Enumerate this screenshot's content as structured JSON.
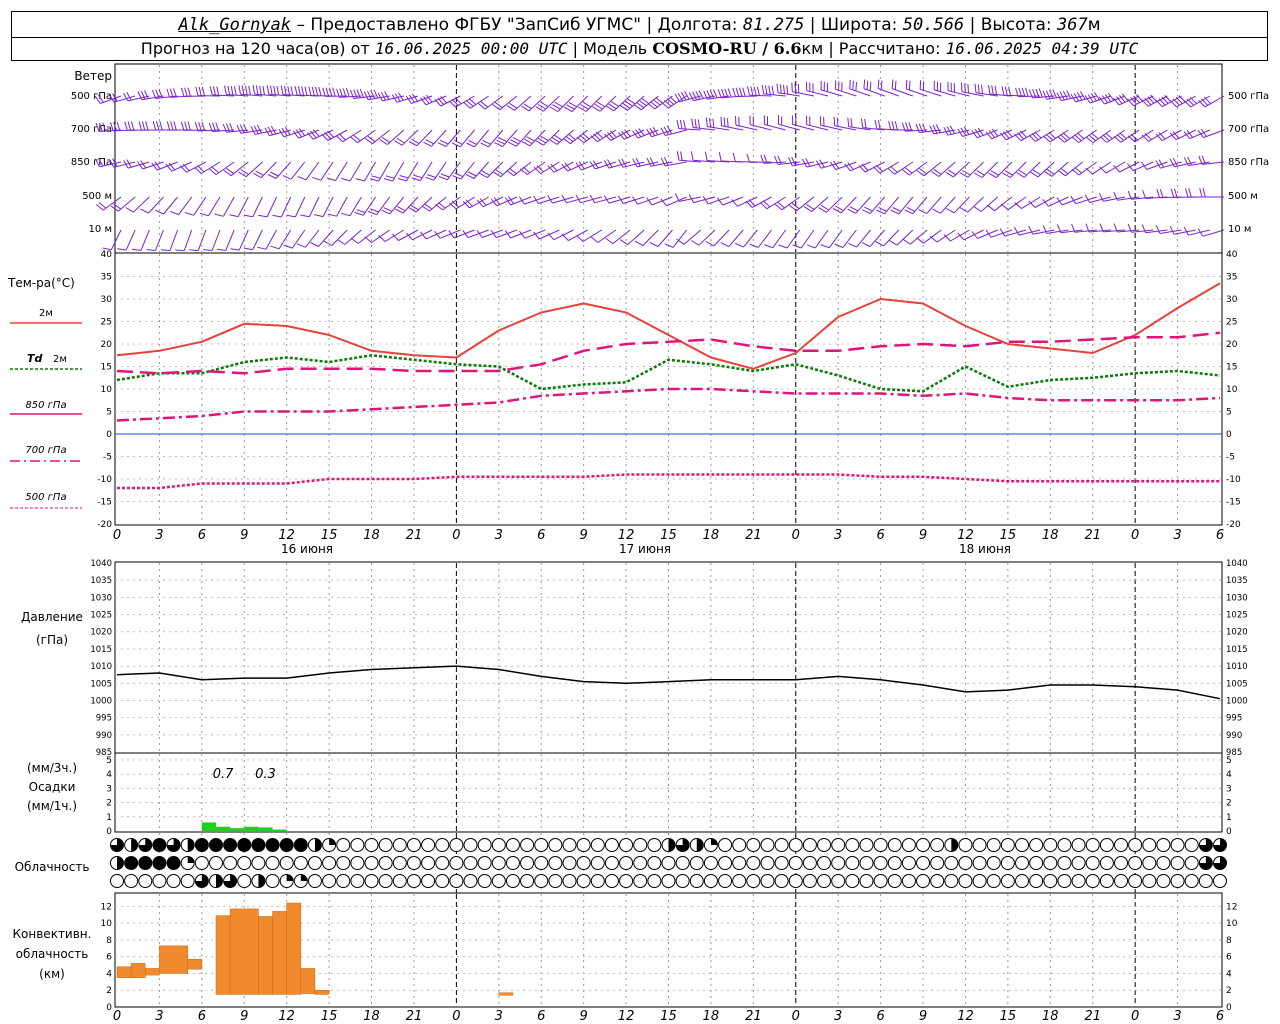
{
  "header": {
    "station": "Alk_Gornyak",
    "provider": "– Предоставлено ФГБУ \"ЗапСиб УГМС\"",
    "lon_label": "| Долгота:",
    "lon": "81.275",
    "lat_label": "| Широта:",
    "lat": "50.566",
    "alt_label": "| Высота:",
    "alt": "367",
    "alt_unit": "м",
    "forecast_label": "Прогноз на 120 часа(ов) от",
    "forecast_from": "16.06.2025 00:00 UTC",
    "model_label": "| Модель",
    "model": "COSMO-RU / 6.6",
    "model_unit": "км",
    "calc_label": "| Рассчитано:",
    "calc_time": "16.06.2025 04:39 UTC"
  },
  "labels": {
    "wind": "Ветер",
    "wind_levels": [
      "500 гПа",
      "700 гПа",
      "850 гПа",
      "500 м",
      "10 м"
    ],
    "temp": "Тем-ра(°С)",
    "t2m": "2м",
    "td_a": "Td",
    "td_b": "2м",
    "t850": "850 гПа",
    "t700": "700 гПа",
    "t500": "500 гПа",
    "pressure_a": "Давление",
    "pressure_b": "(гПа)",
    "precip_a": "(мм/3ч.)",
    "precip_b": "Осадки",
    "precip_c": "(мм/1ч.)",
    "cloud": "Облачность",
    "conv_a": "Конвективн.",
    "conv_b": "облачность",
    "conv_c": "(км)",
    "days": [
      "16 июня",
      "17 июня",
      "18 июня"
    ],
    "hour_ticks": [
      "0",
      "3",
      "6",
      "9",
      "12",
      "15",
      "18",
      "21",
      "0",
      "3",
      "6",
      "9",
      "12",
      "15",
      "18",
      "21",
      "0",
      "3",
      "6",
      "9",
      "12",
      "15",
      "18",
      "21",
      "0",
      "3",
      "6"
    ]
  },
  "colors": {
    "t2m": "#e8413a",
    "td": "#0a7a0a",
    "t850": "#e0157a",
    "t700": "#e0157a",
    "t500": "#e0157a",
    "wind": "#7a22cc",
    "pressure": "#000000",
    "precip": "#22cc22",
    "conv": "#ef8a2e",
    "zero_line": "#2244cc"
  },
  "chart_data": [
    {
      "type": "line",
      "ylabel": "Тем-ра(°С)",
      "ylim": [
        -20,
        40
      ],
      "yticks": [
        -20,
        -15,
        -10,
        -5,
        0,
        5,
        10,
        15,
        20,
        25,
        30,
        35,
        40
      ],
      "x_hours_from_start": [
        0,
        3,
        6,
        9,
        12,
        15,
        18,
        21,
        24,
        27,
        30,
        33,
        36,
        39,
        42,
        45,
        48,
        51,
        54,
        57,
        60,
        63,
        66,
        69,
        72,
        75,
        78
      ],
      "series": [
        {
          "name": "2м",
          "values": [
            17.5,
            18.5,
            20.5,
            24.5,
            24,
            22,
            18.5,
            17.5,
            17,
            23,
            27,
            29,
            27,
            22,
            17,
            14.5,
            18,
            26,
            30,
            29,
            24,
            20,
            19,
            18,
            22,
            28,
            33.5
          ]
        },
        {
          "name": "Td 2м",
          "values": [
            12,
            13.5,
            13.5,
            16,
            17,
            16,
            17.5,
            16.5,
            15.5,
            15,
            10,
            11,
            11.5,
            16.5,
            15.5,
            14,
            15.5,
            13,
            10,
            9.5,
            15,
            10.5,
            12,
            12.5,
            13.5,
            14,
            13
          ]
        },
        {
          "name": "850 гПа",
          "values": [
            14,
            13.5,
            14,
            13.5,
            14.5,
            14.5,
            14.5,
            14,
            14,
            14,
            15.5,
            18.5,
            20,
            20.5,
            21,
            19.5,
            18.5,
            18.5,
            19.5,
            20,
            19.5,
            20.5,
            20.5,
            21,
            21.5,
            21.5,
            22.5
          ]
        },
        {
          "name": "700 гПа",
          "values": [
            3,
            3.5,
            4,
            5,
            5,
            5,
            5.5,
            6,
            6.5,
            7,
            8.5,
            9,
            9.5,
            10,
            10,
            9.5,
            9,
            9,
            9,
            8.5,
            9,
            8,
            7.5,
            7.5,
            7.5,
            7.5,
            8
          ]
        },
        {
          "name": "500 гПа",
          "values": [
            -12,
            -12,
            -11,
            -11,
            -11,
            -10,
            -10,
            -10,
            -9.5,
            -9.5,
            -9.5,
            -9.5,
            -9,
            -9,
            -9,
            -9,
            -9,
            -9,
            -9.5,
            -9.5,
            -10,
            -10.5,
            -10.5,
            -10.5,
            -10.5,
            -10.5,
            -10.5
          ]
        }
      ]
    },
    {
      "type": "line",
      "ylabel": "Давление (гПа)",
      "ylim": [
        985,
        1040
      ],
      "yticks": [
        985,
        990,
        995,
        1000,
        1005,
        1010,
        1015,
        1020,
        1025,
        1030,
        1035,
        1040
      ],
      "x_hours_from_start": [
        0,
        3,
        6,
        9,
        12,
        15,
        18,
        21,
        24,
        27,
        30,
        33,
        36,
        39,
        42,
        45,
        48,
        51,
        54,
        57,
        60,
        63,
        66,
        69,
        72,
        75,
        78
      ],
      "series": [
        {
          "name": "Давление",
          "values": [
            1007.5,
            1008,
            1006,
            1006.5,
            1006.5,
            1008,
            1009,
            1009.5,
            1010,
            1009,
            1007,
            1005.5,
            1005,
            1005.5,
            1006,
            1006,
            1006,
            1007,
            1006,
            1004.5,
            1002.5,
            1003,
            1004.5,
            1004.5,
            1004,
            1003,
            1000.5
          ]
        }
      ]
    },
    {
      "type": "bar",
      "ylabel": "Осадки (мм/1ч.)",
      "ylim": [
        0,
        5
      ],
      "yticks": [
        0,
        1,
        2,
        3,
        4,
        5
      ],
      "x_hours_from_start": [
        6,
        7,
        8,
        9,
        10,
        11
      ],
      "values": [
        0.6,
        0.3,
        0.2,
        0.3,
        0.25,
        0.1
      ],
      "annotations": [
        {
          "hours": [
            6,
            9
          ],
          "text": "0.7"
        },
        {
          "hours": [
            9,
            12
          ],
          "text": "0.3"
        }
      ]
    },
    {
      "type": "bar",
      "ylabel": "Конвективн. облачность (км)",
      "ylim": [
        0,
        13
      ],
      "yticks": [
        0,
        2,
        4,
        6,
        8,
        10,
        12
      ],
      "bars": [
        {
          "x0": 0,
          "x1": 1,
          "bottom": 3.5,
          "top": 4.8
        },
        {
          "x0": 1,
          "x1": 2,
          "bottom": 3.5,
          "top": 5.2
        },
        {
          "x0": 2,
          "x1": 3,
          "bottom": 3.8,
          "top": 4.6
        },
        {
          "x0": 3,
          "x1": 5,
          "bottom": 4,
          "top": 7.3
        },
        {
          "x0": 5,
          "x1": 6,
          "bottom": 4.5,
          "top": 5.7
        },
        {
          "x0": 7,
          "x1": 8,
          "bottom": 1.5,
          "top": 10.9
        },
        {
          "x0": 8,
          "x1": 10,
          "bottom": 1.5,
          "top": 11.7
        },
        {
          "x0": 10,
          "x1": 11,
          "bottom": 1.5,
          "top": 10.8
        },
        {
          "x0": 11,
          "x1": 12,
          "bottom": 1.5,
          "top": 11.4
        },
        {
          "x0": 12,
          "x1": 13,
          "bottom": 1.5,
          "top": 12.4
        },
        {
          "x0": 13,
          "x1": 14,
          "bottom": 1.6,
          "top": 4.6
        },
        {
          "x0": 14,
          "x1": 15,
          "bottom": 1.5,
          "top": 2
        },
        {
          "x0": 27,
          "x1": 28,
          "bottom": 1.4,
          "top": 1.7
        }
      ]
    }
  ]
}
